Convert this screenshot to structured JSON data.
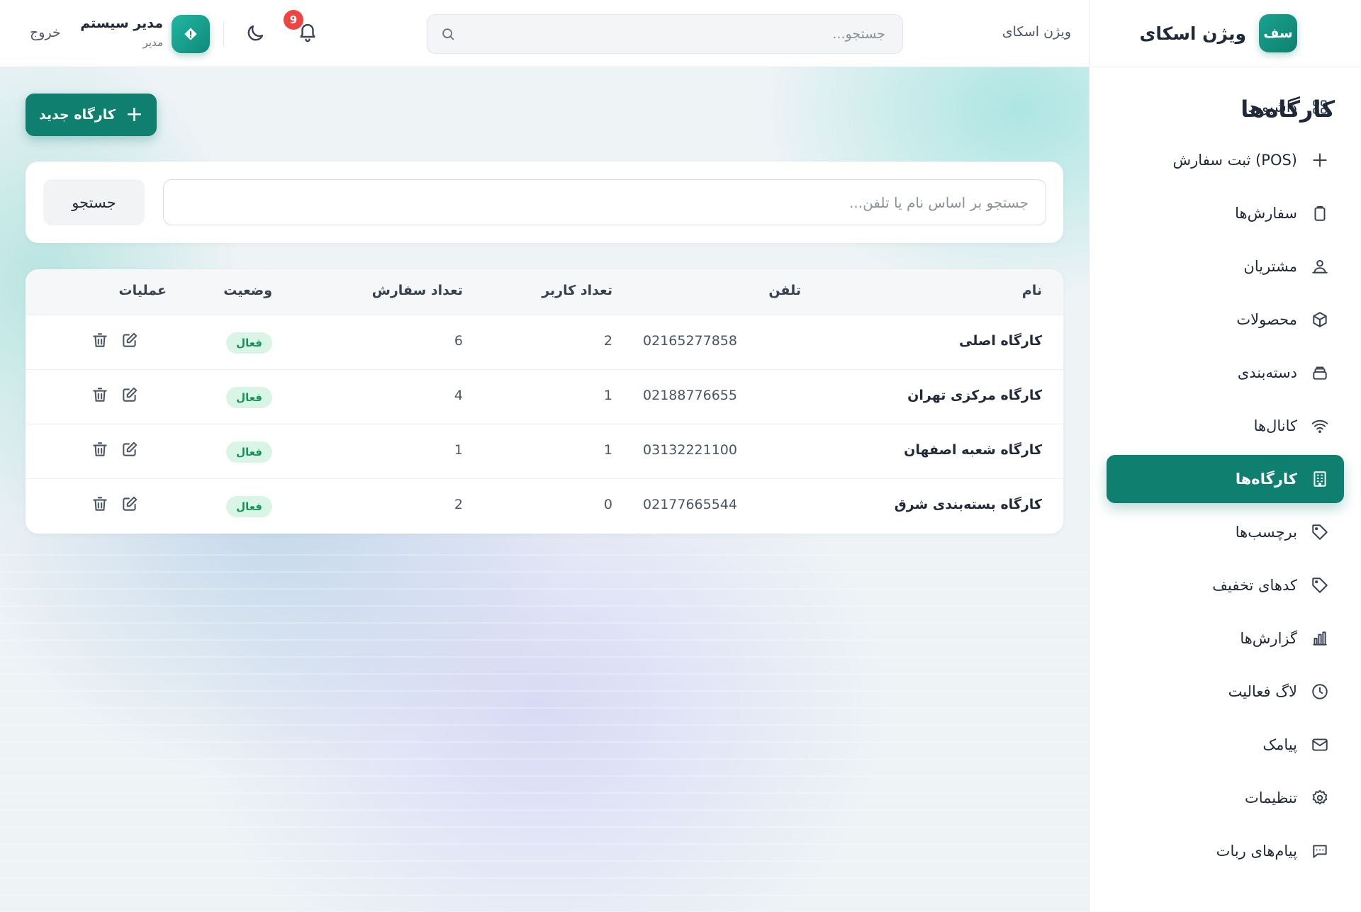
{
  "brand": {
    "name": "ویژن اسکای",
    "logo_text": "سف"
  },
  "topbar": {
    "breadcrumb": "ویژن اسکای",
    "search_placeholder": "جستجو...",
    "notification_count": "9",
    "user_name": "مدیر سیستم",
    "user_role": "مدیر",
    "logout_label": "خروج"
  },
  "sidebar": {
    "items": [
      {
        "label": "داشبورد",
        "icon": "grid-icon"
      },
      {
        "label": "ثبت سفارش (POS)",
        "icon": "plus-icon"
      },
      {
        "label": "سفارش‌ها",
        "icon": "clipboard-icon"
      },
      {
        "label": "مشتریان",
        "icon": "users-icon"
      },
      {
        "label": "محصولات",
        "icon": "box-icon"
      },
      {
        "label": "دسته‌بندی",
        "icon": "layers-icon"
      },
      {
        "label": "کانال‌ها",
        "icon": "wifi-icon"
      },
      {
        "label": "کارگاه‌ها",
        "icon": "building-icon",
        "active": true
      },
      {
        "label": "برچسب‌ها",
        "icon": "tag-icon"
      },
      {
        "label": "کدهای تخفیف",
        "icon": "tag-icon"
      },
      {
        "label": "گزارش‌ها",
        "icon": "bar-chart-icon"
      },
      {
        "label": "لاگ فعالیت",
        "icon": "clock-icon"
      },
      {
        "label": "پیامک",
        "icon": "mail-icon"
      },
      {
        "label": "تنظیمات",
        "icon": "gear-icon"
      },
      {
        "label": "پیام‌های ربات",
        "icon": "message-icon"
      }
    ]
  },
  "page": {
    "title": "کارگاه‌ها",
    "new_button_label": "کارگاه جدید",
    "search_placeholder": "جستجو بر اساس نام یا تلفن...",
    "search_button_label": "جستجو"
  },
  "table": {
    "headers": {
      "name": "نام",
      "phone": "تلفن",
      "users": "تعداد کاربر",
      "orders": "تعداد سفارش",
      "status": "وضعیت",
      "actions": "عملیات"
    },
    "rows": [
      {
        "name": "کارگاه اصلی",
        "phone": "02165277858",
        "users": "2",
        "orders": "6",
        "status": "فعال"
      },
      {
        "name": "کارگاه مرکزی تهران",
        "phone": "02188776655",
        "users": "1",
        "orders": "4",
        "status": "فعال"
      },
      {
        "name": "کارگاه شعبه اصفهان",
        "phone": "03132221100",
        "users": "1",
        "orders": "1",
        "status": "فعال"
      },
      {
        "name": "کارگاه بسته‌بندی شرق",
        "phone": "02177665544",
        "users": "0",
        "orders": "2",
        "status": "فعال"
      }
    ]
  },
  "colors": {
    "accent": "#0f7f70",
    "status_bg": "#d9f5e6",
    "status_text": "#15935b",
    "badge": "#ef4444"
  }
}
